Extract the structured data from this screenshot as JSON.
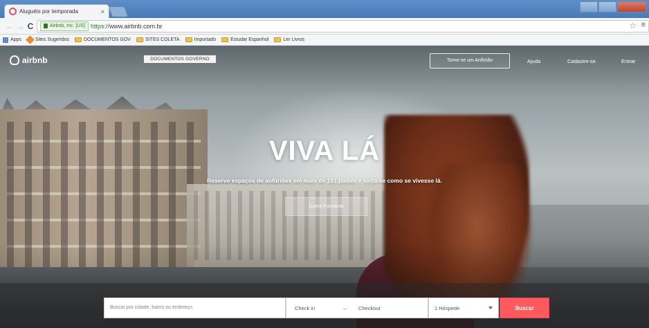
{
  "browser": {
    "tab_title": "Aluguéis por temporada",
    "tab_close": "×",
    "url_secure_label": "Airbnb, Inc. [US]",
    "url_scheme": "https://",
    "url_rest": "www.airbnb.com.br",
    "star": "☆",
    "menu": "≡",
    "bookmarks": [
      {
        "label": "Apps",
        "icon": "apps-grid-icon"
      },
      {
        "label": "Sites Sugeridos",
        "icon": "bookmark-favicon"
      },
      {
        "label": "DOCUMENTOS GOV",
        "icon": "folder-icon"
      },
      {
        "label": "SITES COLETA",
        "icon": "folder-icon"
      },
      {
        "label": "Importado",
        "icon": "folder-icon"
      },
      {
        "label": "Estudar Espanhol",
        "icon": "folder-icon"
      },
      {
        "label": "Ler Livros",
        "icon": "folder-icon"
      }
    ]
  },
  "header": {
    "logo_text": "airbnb",
    "gov_tag": "DOCUMENTOS GOVERNO",
    "host_button": "Torne-se um Anfitrião",
    "help_link": "Ajuda",
    "signup_link": "Cadastre-se",
    "login_link": "Entrar"
  },
  "hero": {
    "headline": "VIVA LÁ",
    "subhead": "Reserve espaços de anfitriões em mais de 191 países e sinta-se como se vivesse lá.",
    "explore_button": "Como Funciona"
  },
  "search": {
    "placeholder": "Buscar por cidade, bairro ou endereço",
    "checkin": "Check in",
    "arrow": "→",
    "checkout": "Checkout",
    "guests": "1 Hóspede",
    "button": "Buscar"
  },
  "colors": {
    "accent": "#ff5a5f"
  }
}
